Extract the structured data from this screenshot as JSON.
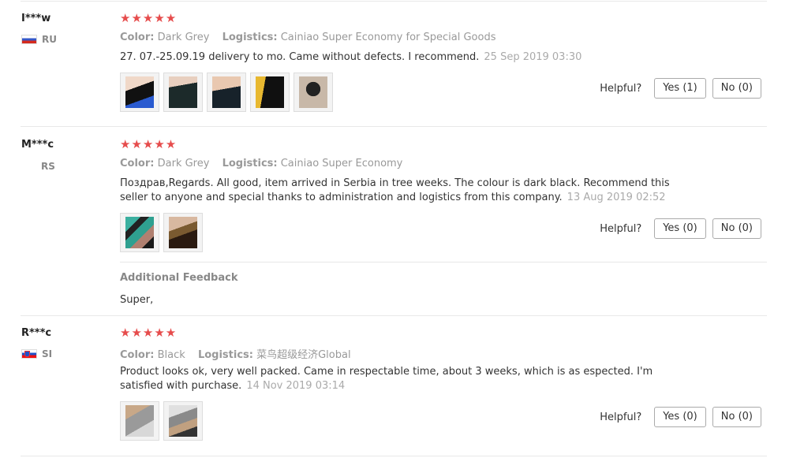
{
  "reviews": [
    {
      "user": "I***w",
      "country": "RU",
      "stars": "★★★★★",
      "color_label": "Color:",
      "color": "Dark Grey",
      "logistics_label": "Logistics:",
      "logistics": "Cainiao Super Economy for Special Goods",
      "text": "27. 07.-25.09.19 delivery to mo. Came without defects. I recommend.",
      "date": "25 Sep 2019 03:30",
      "helpful_label": "Helpful?",
      "yes": "Yes (1)",
      "no": "No (0)"
    },
    {
      "user": "M***c",
      "country": "RS",
      "stars": "★★★★★",
      "color_label": "Color:",
      "color": "Dark Grey",
      "logistics_label": "Logistics:",
      "logistics": "Cainiao Super Economy",
      "text": "Поздрав,Regards. All good, item arrived in Serbia in tree weeks. The colour is dark black. Recommend this seller to anyone and special thanks to administration and logistics from this company.",
      "date": "13 Aug 2019 02:52",
      "helpful_label": "Helpful?",
      "yes": "Yes (0)",
      "no": "No (0)",
      "additional_title": "Additional Feedback",
      "additional_text": "Super,"
    },
    {
      "user": "R***c",
      "country": "SI",
      "stars": "★★★★★",
      "color_label": "Color:",
      "color": "Black",
      "logistics_label": "Logistics:",
      "logistics": "菜鸟超级经济Global",
      "text": "Product looks ok, very well packed. Came in respectable time, about 3 weeks, which is as espected. I'm satisfied with purchase.",
      "date": "14 Nov 2019 03:14",
      "helpful_label": "Helpful?",
      "yes": "Yes (0)",
      "no": "No (0)"
    }
  ]
}
